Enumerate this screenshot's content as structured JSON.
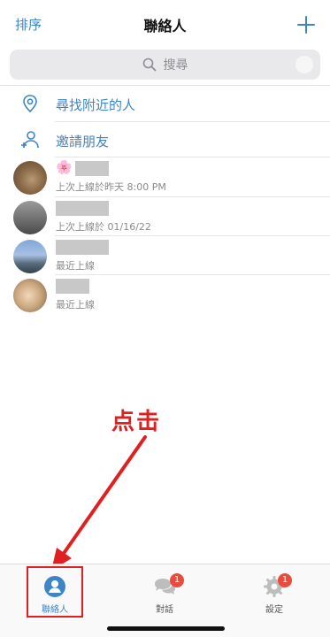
{
  "header": {
    "sort_label": "排序",
    "title": "聯絡人",
    "add_icon": "plus-icon"
  },
  "search": {
    "placeholder": "搜尋",
    "icon": "search-icon"
  },
  "actions": [
    {
      "label": "尋找附近的人",
      "icon": "location-pin-icon"
    },
    {
      "label": "邀請朋友",
      "icon": "add-person-icon"
    }
  ],
  "contacts": [
    {
      "name_prefix": "🌸",
      "status": "上次上線於昨天 8:00 PM"
    },
    {
      "status": "上次上線於 01/16/22"
    },
    {
      "status": "最近上線"
    },
    {
      "status": "最近上線"
    }
  ],
  "annotation": {
    "text": "点击"
  },
  "tabs": [
    {
      "label": "聯絡人",
      "icon": "person-icon",
      "active": true
    },
    {
      "label": "對話",
      "icon": "chat-bubbles-icon",
      "badge": "1"
    },
    {
      "label": "設定",
      "icon": "gear-icon",
      "badge": "1"
    }
  ],
  "colors": {
    "accent": "#3d85c6",
    "annotation": "#e02020",
    "badge": "#e74c3c"
  }
}
